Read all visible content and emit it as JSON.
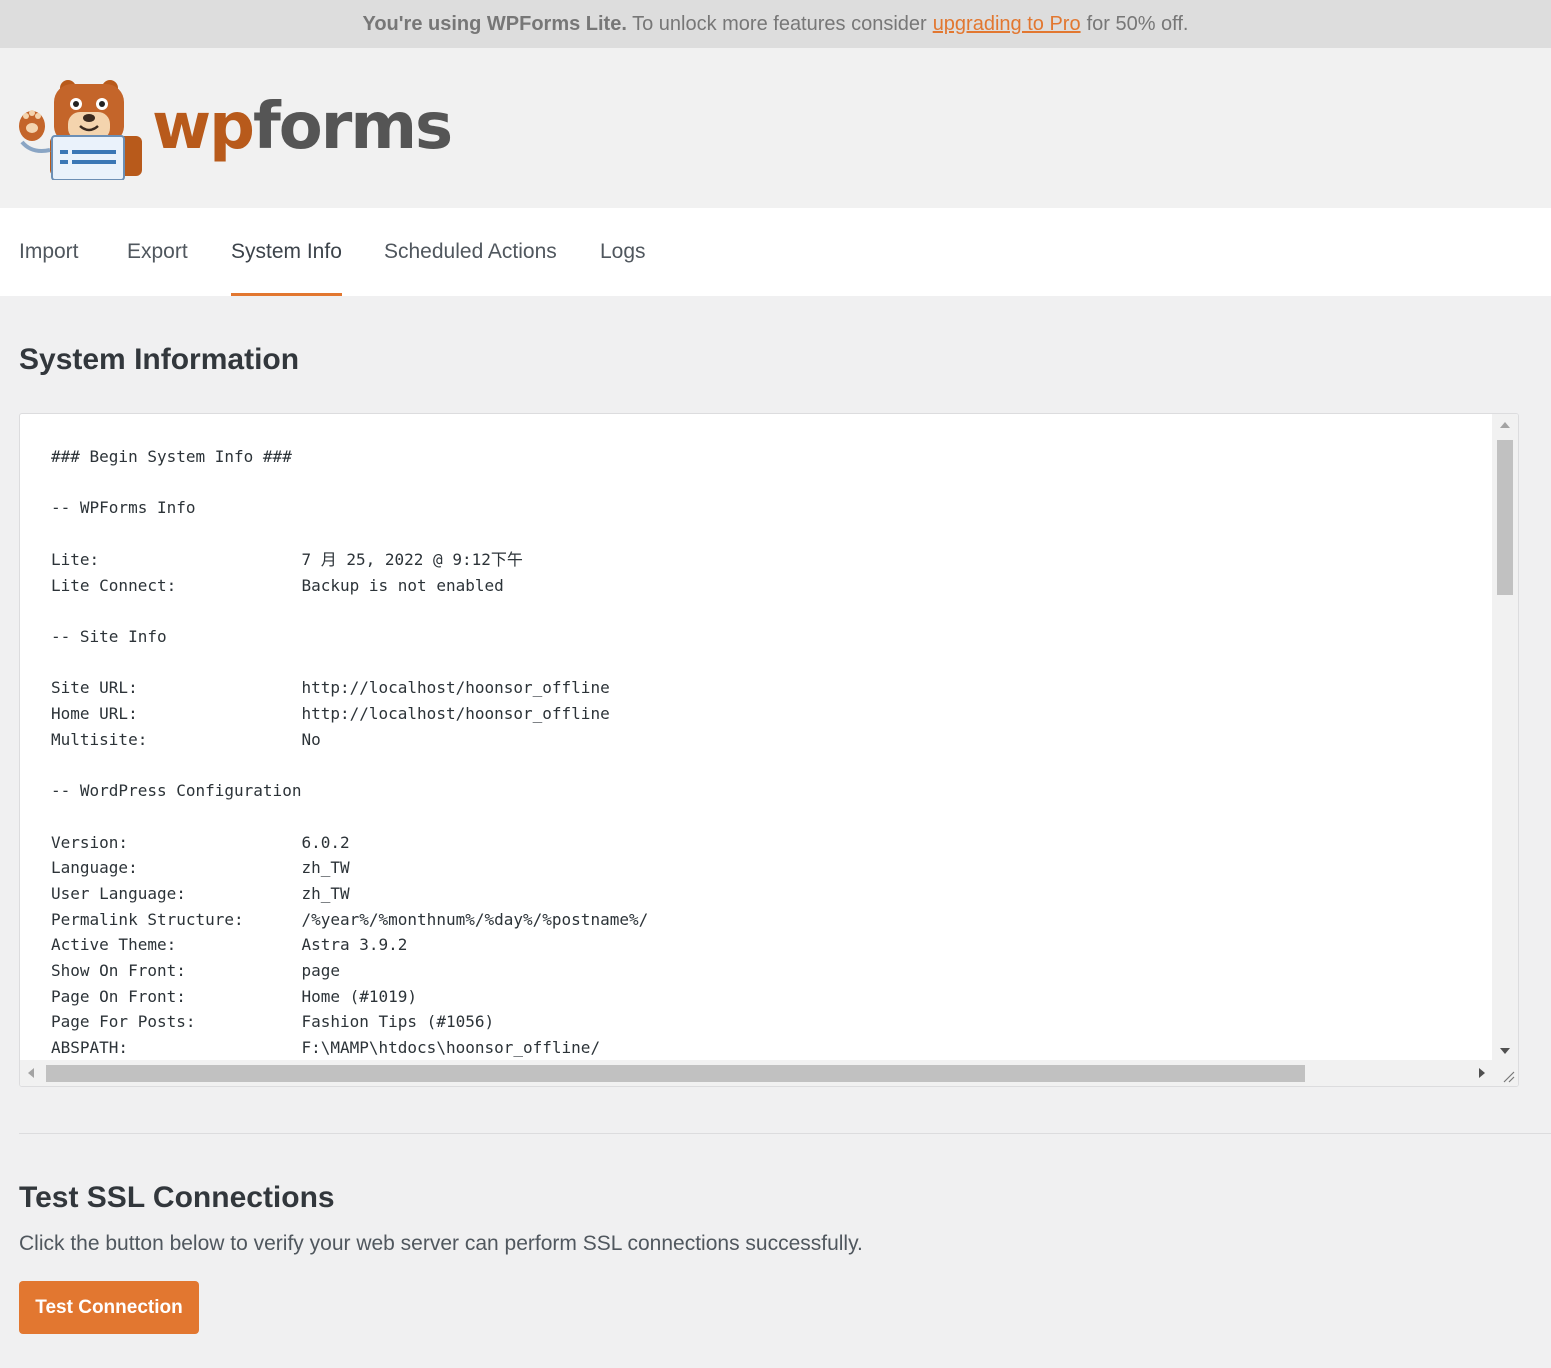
{
  "notice": {
    "bold": "You're using WPForms Lite.",
    "text1": " To unlock more features consider",
    "link": "upgrading to Pro",
    "text2": "for 50% off."
  },
  "brand": {
    "wp": "wp",
    "forms": "forms",
    "accent": "#e27730"
  },
  "tabs": [
    {
      "label": "Import"
    },
    {
      "label": "Export"
    },
    {
      "label": "System Info",
      "active": true
    },
    {
      "label": "Scheduled Actions"
    },
    {
      "label": "Logs"
    }
  ],
  "system_info": {
    "title": "System Information",
    "content": "### Begin System Info ###\n\n-- WPForms Info\n\nLite:                     7 月 25, 2022 @ 9:12下午\nLite Connect:             Backup is not enabled\n\n-- Site Info\n\nSite URL:                 http://localhost/hoonsor_offline\nHome URL:                 http://localhost/hoonsor_offline\nMultisite:                No\n\n-- WordPress Configuration\n\nVersion:                  6.0.2\nLanguage:                 zh_TW\nUser Language:            zh_TW\nPermalink Structure:      /%year%/%monthnum%/%day%/%postname%/\nActive Theme:             Astra 3.9.2\nShow On Front:            page\nPage On Front:            Home (#1019)\nPage For Posts:           Fashion Tips (#1056)\nABSPATH:                  F:\\MAMP\\htdocs\\hoonsor_offline/"
  },
  "ssl": {
    "title": "Test SSL Connections",
    "description": "Click the button below to verify your web server can perform SSL connections successfully.",
    "button": "Test Connection"
  }
}
